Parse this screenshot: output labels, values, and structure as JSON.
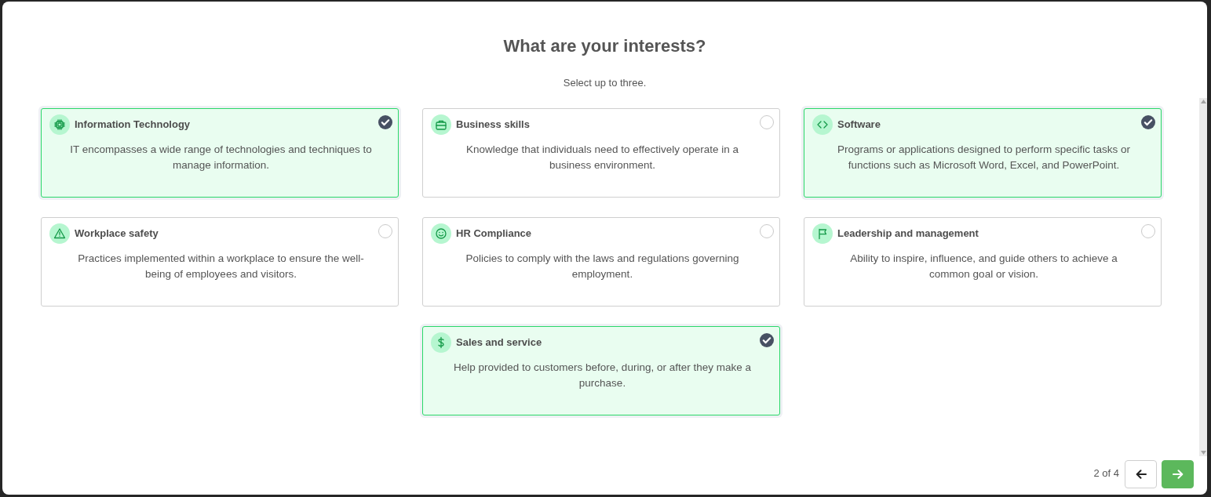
{
  "dialog": {
    "title": "What are your interests?",
    "subtitle": "Select up to three."
  },
  "interests": [
    {
      "title": "Information Technology",
      "description": "IT encompasses a wide range of technologies and techniques to manage information.",
      "selected": true
    },
    {
      "title": "Business skills",
      "description": "Knowledge that individuals need to effectively operate in a business environment.",
      "selected": false
    },
    {
      "title": "Software",
      "description": "Programs or applications designed to perform specific tasks or functions such as Microsoft Word, Excel, and PowerPoint.",
      "selected": true
    },
    {
      "title": "Workplace safety",
      "description": "Practices implemented within a workplace to ensure the well-being of employees and visitors.",
      "selected": false
    },
    {
      "title": "HR Compliance",
      "description": "Policies to comply with the laws and regulations governing employment.",
      "selected": false
    },
    {
      "title": "Leadership and management",
      "description": "Ability to inspire, influence, and guide others to achieve a common goal or vision.",
      "selected": false
    },
    {
      "title": "Sales and service",
      "description": "Help provided to customers before, during, or after they make a purchase.",
      "selected": true
    }
  ],
  "pager": {
    "position": "2 of 4"
  }
}
